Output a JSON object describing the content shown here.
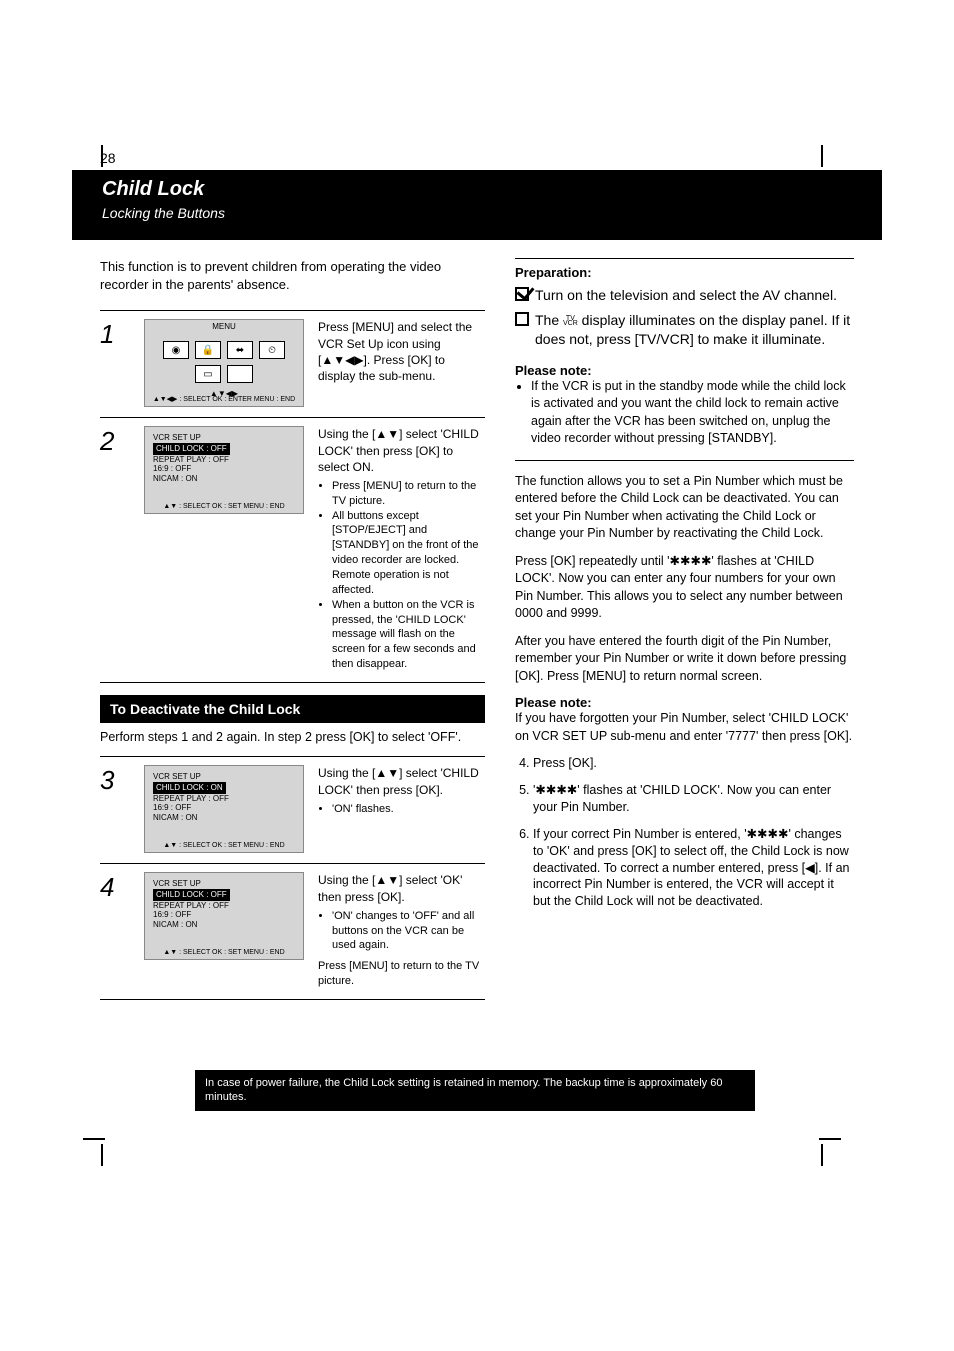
{
  "page_number": "28",
  "header": {
    "title": "Child Lock",
    "subtitle": "Locking the Buttons"
  },
  "left": {
    "intro": "This function is to prevent children from operating the video recorder in the parents' absence.",
    "step1": {
      "heading": "Press [MENU] and select the VCR Set Up icon using [▲▼◀▶]. Press [OK] to display the sub-menu.",
      "osd": "MENU",
      "osd_bottom": "▲▼◀▶ : SELECT  OK : ENTER  MENU : END"
    },
    "step2": {
      "heading": "Using the [▲▼] select 'CHILD LOCK' then press [OK] to select ON.",
      "menu_title": "VCR SET UP",
      "menu_items": [
        "CHILD LOCK : OFF",
        "REPEAT PLAY : OFF",
        "16:9 : OFF",
        "NICAM : ON"
      ],
      "osd_bottom": "▲▼ : SELECT  OK : SET  MENU : END",
      "bullets": [
        "Press [MENU] to return to the TV picture.",
        "All buttons except [STOP/EJECT] and [STANDBY] on the front of the video recorder are locked. Remote operation is not affected.",
        "When a button on the VCR is pressed, the 'CHILD LOCK' message will flash on the screen for a few seconds and then disappear."
      ]
    },
    "black_strip1": "To Deactivate the Child Lock",
    "deact_text": "Perform steps 1 and 2 again. In step 2 press [OK] to select 'OFF'.",
    "step3": {
      "heading": "Using the [▲▼] select 'CHILD LOCK' then press [OK].",
      "menu_title": "VCR SET UP",
      "menu_items": [
        "CHILD LOCK : ON",
        "REPEAT PLAY : OFF",
        "16:9 : OFF",
        "NICAM : ON"
      ],
      "osd_bottom": "▲▼ : SELECT  OK : SET  MENU : END",
      "bullets": [
        "'ON' flashes."
      ]
    },
    "step4": {
      "heading": "Using the [▲▼] select 'OK' then press [OK].",
      "menu_title": "VCR SET UP",
      "menu_items": [
        "CHILD LOCK : OFF",
        "REPEAT PLAY : OFF",
        "16:9 : OFF",
        "NICAM : ON"
      ],
      "osd_bottom": "▲▼ : SELECT  OK : SET  MENU : END",
      "bullets": [
        "'ON' changes to 'OFF' and all buttons on the VCR can be used again."
      ],
      "after": "Press [MENU] to return to the TV picture."
    }
  },
  "right": {
    "check1_text": "Turn on the television and select the AV channel.",
    "check2_text": "The ",
    "check2_suffix": " display illuminates on the display panel. If it does not, press [TV/VCR] to make it illuminate.",
    "tvvcr": "TV\nVCR",
    "note_heading": "Please note:",
    "notes": [
      "If the VCR is put in the standby mode while the child lock is activated and you want the child lock to remain active again after the VCR has been switched on, unplug the video recorder without pressing [STANDBY]."
    ],
    "sep_label": "",
    "pin_text1": "The function allows you to set a Pin Number which must be entered before the Child Lock can be deactivated. You can set your Pin Number when activating the Child Lock or change your Pin Number by reactivating the Child Lock.",
    "pin_text2": "Press [OK] repeatedly until '✱✱✱✱' flashes at 'CHILD LOCK'. Now you can enter any four numbers for your own Pin Number. This allows you to select any number between 0000 and 9999.",
    "pin_text3": "After you have entered the fourth digit of the Pin Number, remember your Pin Number or write it down before pressing [OK]. Press [MENU] to return normal screen.",
    "pin_note_label": "Please note:",
    "pin_note": "If you have forgotten your Pin Number, select 'CHILD LOCK' on VCR SET UP sub-menu and enter '7777' then press [OK].",
    "deact_steps_heading": "",
    "deact_steps": [
      "Press [OK].",
      "'✱✱✱✱' flashes at 'CHILD LOCK'. Now you can enter your Pin Number.",
      "If your correct Pin Number is entered, '✱✱✱✱' changes to 'OK' and press [OK] to select off, the Child Lock is now deactivated. To correct a number entered, press [◀]. If an incorrect Pin Number is entered, the VCR will accept it but the Child Lock will not be deactivated."
    ]
  },
  "footer": "In case of power failure, the Child Lock setting is retained in memory. The backup time is approximately 60 minutes."
}
